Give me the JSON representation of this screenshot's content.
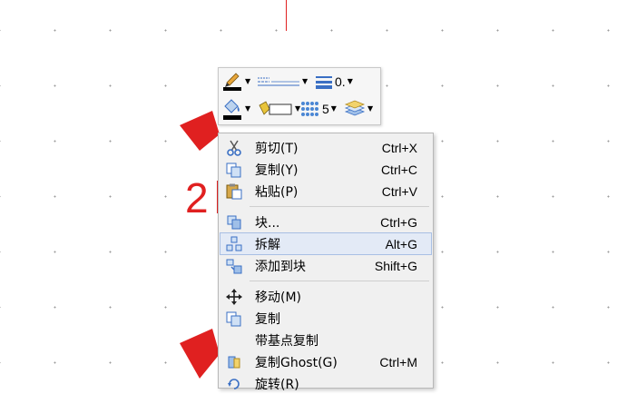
{
  "annotation": {
    "step_number": "2"
  },
  "mini_toolbar": {
    "line_weight_value": "0.",
    "transparency_value": "5",
    "colors": {
      "line_color": "#000000",
      "fill_color": "#000000"
    }
  },
  "context_menu": {
    "items": [
      {
        "label": "剪切(T)",
        "shortcut": "Ctrl+X",
        "icon": "cut-icon"
      },
      {
        "label": "复制(Y)",
        "shortcut": "Ctrl+C",
        "icon": "copy-icon"
      },
      {
        "label": "粘贴(P)",
        "shortcut": "Ctrl+V",
        "icon": "paste-icon"
      },
      {
        "label": "块...",
        "shortcut": "Ctrl+G",
        "icon": "block-icon"
      },
      {
        "label": "拆解",
        "shortcut": "Alt+G",
        "icon": "explode-icon"
      },
      {
        "label": "添加到块",
        "shortcut": "Shift+G",
        "icon": "add-to-block-icon"
      },
      {
        "label": "移动(M)",
        "shortcut": "",
        "icon": "move-icon"
      },
      {
        "label": "复制",
        "shortcut": "",
        "icon": "duplicate-icon"
      },
      {
        "label": "带基点复制",
        "shortcut": "",
        "icon": ""
      },
      {
        "label": "复制Ghost(G)",
        "shortcut": "Ctrl+M",
        "icon": "copy-ghost-icon"
      },
      {
        "label": "旋转(R)",
        "shortcut": "",
        "icon": "rotate-icon"
      }
    ],
    "hovered_item": "拆解"
  },
  "colors": {
    "annotation_red": "#e02020",
    "menu_background": "#f0f0f0",
    "menu_hover": "#e3eaf6"
  }
}
